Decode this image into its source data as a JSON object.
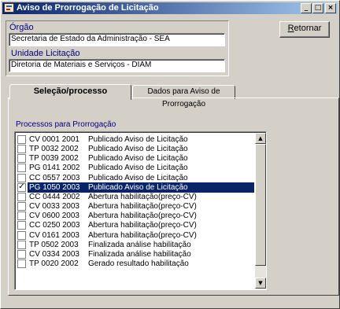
{
  "window": {
    "title": "Aviso de Prorrogação de Licitação",
    "minimize": "_",
    "maximize": "□",
    "close": "×"
  },
  "orgao": {
    "label": "Órgão",
    "value": "Secretaria de Estado da Administração - SEA"
  },
  "unidade": {
    "label": "Unidade Licitação",
    "value": "Diretoria de Materiais e Serviços - DIAM"
  },
  "retornar": {
    "underlined": "R",
    "rest": "etornar"
  },
  "tabs": [
    {
      "label": "Seleção/processo",
      "active": true
    },
    {
      "label": "Dados para Aviso de Prorrogação",
      "active": false
    }
  ],
  "process_list": {
    "label": "Processos para Prorrogação",
    "items": [
      {
        "code": "CV 0001 2001",
        "status": "Publicado Aviso de Licitação",
        "checked": false,
        "selected": false
      },
      {
        "code": "TP 0032 2002",
        "status": "Publicado Aviso de Licitação",
        "checked": false,
        "selected": false
      },
      {
        "code": "TP 0039 2002",
        "status": "Publicado Aviso de Licitação",
        "checked": false,
        "selected": false
      },
      {
        "code": "PG 0141 2002",
        "status": "Publicado Aviso de Licitação",
        "checked": false,
        "selected": false
      },
      {
        "code": "CC 0557 2003",
        "status": "Publicado Aviso de Licitação",
        "checked": false,
        "selected": false
      },
      {
        "code": "PG 1050 2003",
        "status": "Publicado Aviso de Licitação",
        "checked": true,
        "selected": true
      },
      {
        "code": "CC 0444 2002",
        "status": "Abertura  habilitação(preço-CV)",
        "checked": false,
        "selected": false
      },
      {
        "code": "CV 0033 2003",
        "status": "Abertura  habilitação(preço-CV)",
        "checked": false,
        "selected": false
      },
      {
        "code": "CV 0600 2003",
        "status": "Abertura  habilitação(preço-CV)",
        "checked": false,
        "selected": false
      },
      {
        "code": "CC 0250 2003",
        "status": "Abertura  habilitação(preço-CV)",
        "checked": false,
        "selected": false
      },
      {
        "code": "CV 0161 2003",
        "status": "Abertura  habilitação(preço-CV)",
        "checked": false,
        "selected": false
      },
      {
        "code": "TP 0502 2003",
        "status": "Finalizada análise habilitação",
        "checked": false,
        "selected": false
      },
      {
        "code": "CV 0334 2003",
        "status": "Finalizada análise habilitação",
        "checked": false,
        "selected": false
      },
      {
        "code": "TP 0020 2002",
        "status": "Gerado resultado habilitação",
        "checked": false,
        "selected": false
      }
    ]
  },
  "scrollbar": {
    "up": "▲",
    "down": "▼"
  }
}
